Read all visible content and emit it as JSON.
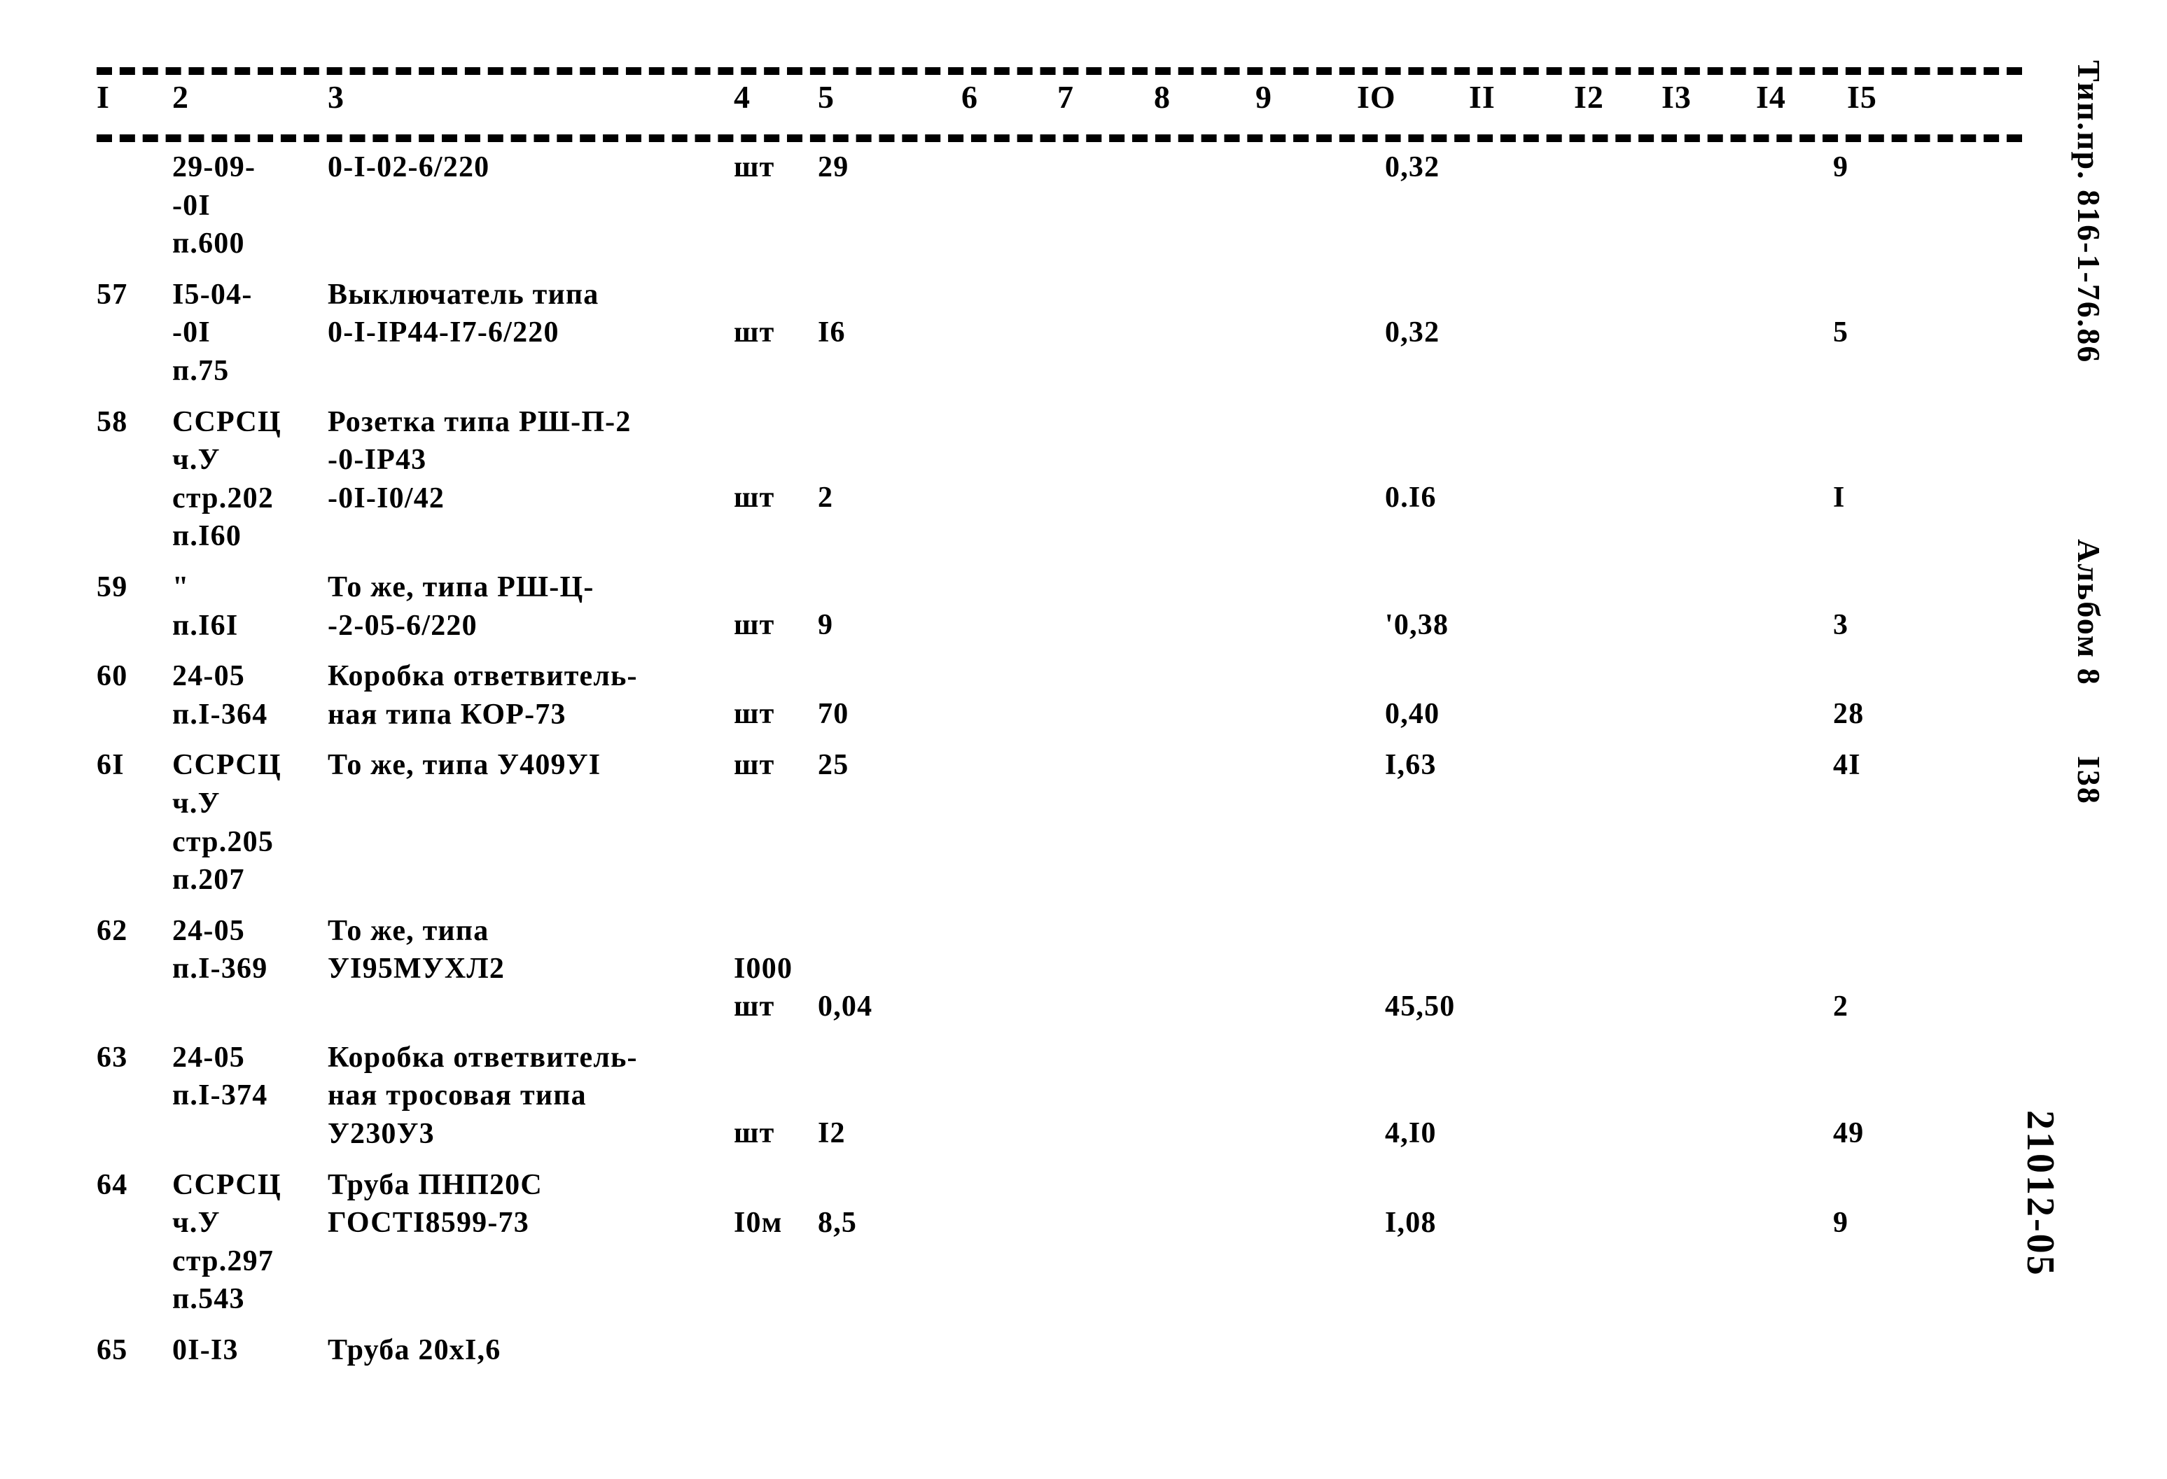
{
  "document": {
    "header_columns": [
      "I",
      "2",
      "3",
      "4",
      "5",
      "6",
      "7",
      "8",
      "9",
      "IO",
      "II",
      "I2",
      "I3",
      "I4",
      "I5"
    ],
    "margin_notes": {
      "type_project": "Тип.пр. 816-1-76.86",
      "album": "Альбом 8",
      "page_number": "I38",
      "stamp": "21012-05"
    }
  },
  "rows": [
    {
      "pos": "",
      "justification": "29-09-\n-0I\nп.600",
      "name": "0-I-02-6/220",
      "unit": "шт",
      "qty": "29",
      "col9": "0,32",
      "col13": "9"
    },
    {
      "pos": "57",
      "justification": "I5-04-\n-0I\nп.75",
      "name": "Выключатель типа\n0-I-IP44-I7-6/220",
      "unit": "шт",
      "qty": "I6",
      "col9": "0,32",
      "col13": "5"
    },
    {
      "pos": "58",
      "justification": "ССРСЦ\nч.У\nстр.202\nп.I60",
      "name": "Розетка типа РШ-П-2\n-0-IP43\n-0I-I0/42",
      "unit": "шт",
      "qty": "2",
      "col9": "0.I6",
      "col13": "I"
    },
    {
      "pos": "59",
      "justification": "\"\nп.I6I",
      "name": "То же, типа РШ-Ц-\n-2-05-6/220",
      "unit": "шт",
      "qty": "9",
      "col9": "'0,38",
      "col13": "3"
    },
    {
      "pos": "60",
      "justification": "24-05\nп.I-364",
      "name": "Коробка ответвитель-\nная типа КОР-73",
      "unit": "шт",
      "qty": "70",
      "col9": "0,40",
      "col13": "28"
    },
    {
      "pos": "6I",
      "justification": "ССРСЦ\nч.У\nстр.205\nп.207",
      "name": "То же, типа У409УI",
      "unit": "шт",
      "qty": "25",
      "col9": "I,63",
      "col13": "4I"
    },
    {
      "pos": "62",
      "justification": "24-05\nп.I-369",
      "name": "То же, типа\nУI95МУХЛ2",
      "unit": "I000\nшт",
      "qty": "0,04",
      "col9": "45,50",
      "col13": "2"
    },
    {
      "pos": "63",
      "justification": "24-05\nп.I-374",
      "name": "Коробка ответвитель-\nная тросовая типа\nУ230У3",
      "unit": "шт",
      "qty": "I2",
      "col9": "4,I0",
      "col13": "49"
    },
    {
      "pos": "64",
      "justification": "ССРСЦ\nч.У\nстр.297\nп.543",
      "name": "Труба ПНП20С\nГОСТI8599-73",
      "unit": "I0м",
      "qty": "8,5",
      "col9": "I,08",
      "col13": "9"
    },
    {
      "pos": "65",
      "justification": "0I-I3",
      "name": "Труба 20xI,6",
      "unit": "",
      "qty": "",
      "col9": "",
      "col13": ""
    }
  ]
}
